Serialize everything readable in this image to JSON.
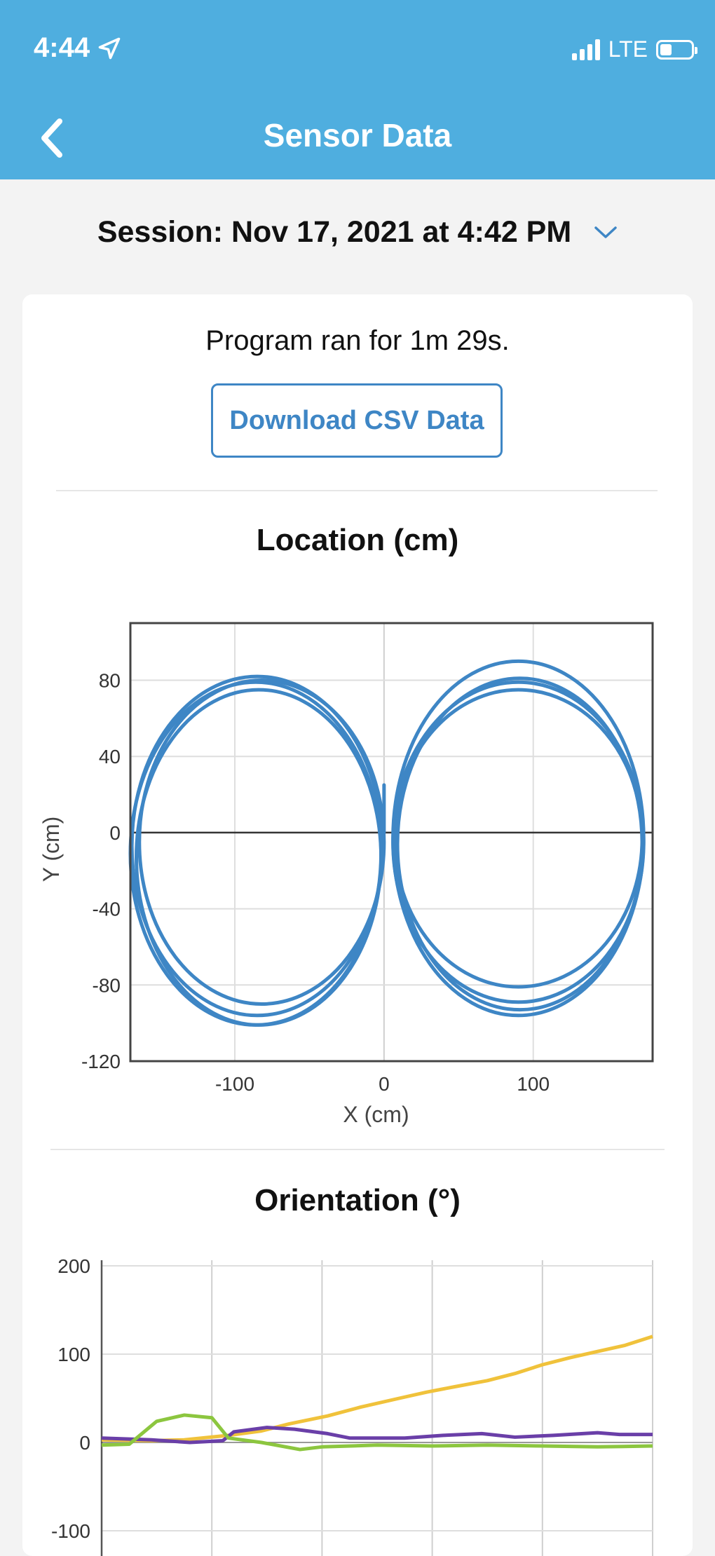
{
  "status_bar": {
    "time": "4:44",
    "network": "LTE"
  },
  "nav": {
    "title": "Sensor Data"
  },
  "session": {
    "label": "Session: Nov 17, 2021 at 4:42 PM"
  },
  "summary": {
    "runtime": "Program ran for 1m 29s."
  },
  "actions": {
    "download_csv": "Download CSV Data"
  },
  "colors": {
    "header": "#4faedf",
    "accent": "#3e86c5",
    "orientation_yellow": "#f0c23b",
    "orientation_purple": "#6a3fa8",
    "orientation_green": "#8cc63f"
  },
  "chart_data": [
    {
      "type": "line",
      "title": "Location (cm)",
      "xlabel": "X (cm)",
      "ylabel": "Y (cm)",
      "xlim": [
        -170,
        180
      ],
      "ylim": [
        -120,
        110
      ],
      "x_ticks": [
        "-100",
        "0",
        "100"
      ],
      "y_ticks": [
        "80",
        "40",
        "0",
        "-40",
        "-80",
        "-120"
      ],
      "grid": true,
      "series": [
        {
          "color": "#3e86c5",
          "loops": [
            {
              "cx": -82,
              "cy": -5,
              "rx": 82,
              "ry": 85
            },
            {
              "cx": -85,
              "cy": -7,
              "rx": 84,
              "ry": 89
            },
            {
              "cx": -86,
              "cy": -11,
              "rx": 84,
              "ry": 90
            },
            {
              "cx": -84,
              "cy": -13,
              "rx": 82,
              "ry": 88
            },
            {
              "cx": 90,
              "cy": -3,
              "rx": 83,
              "ry": 78
            },
            {
              "cx": 90,
              "cy": -5,
              "rx": 84,
              "ry": 84
            },
            {
              "cx": 90,
              "cy": -3,
              "rx": 84,
              "ry": 93
            },
            {
              "cx": 91,
              "cy": -6,
              "rx": 82,
              "ry": 87
            }
          ]
        }
      ]
    },
    {
      "type": "line",
      "title": "Orientation (°)",
      "ylim": [
        -100,
        200
      ],
      "y_ticks": [
        "200",
        "100",
        "0",
        "-100"
      ],
      "x_segments": 5,
      "grid": true,
      "series": [
        {
          "color": "#f0c23b",
          "x": [
            0,
            0.09,
            0.15,
            0.23,
            0.29,
            0.34,
            0.41,
            0.47,
            0.54,
            0.59,
            0.64,
            0.7,
            0.75,
            0.8,
            0.85,
            0.9,
            0.95,
            1.0
          ],
          "values": [
            3,
            2,
            3,
            8,
            13,
            21,
            30,
            40,
            50,
            57,
            63,
            70,
            78,
            88,
            96,
            103,
            110,
            120
          ]
        },
        {
          "color": "#6a3fa8",
          "x": [
            0,
            0.09,
            0.16,
            0.22,
            0.24,
            0.3,
            0.35,
            0.41,
            0.45,
            0.55,
            0.62,
            0.69,
            0.75,
            0.82,
            0.9,
            0.94,
            1.0
          ],
          "values": [
            5,
            3,
            0,
            2,
            12,
            17,
            15,
            10,
            5,
            5,
            8,
            10,
            6,
            8,
            11,
            9,
            9
          ]
        },
        {
          "color": "#8cc63f",
          "x": [
            0,
            0.05,
            0.1,
            0.15,
            0.2,
            0.23,
            0.29,
            0.36,
            0.4,
            0.5,
            0.6,
            0.7,
            0.8,
            0.9,
            1.0
          ],
          "values": [
            -3,
            -2,
            24,
            31,
            28,
            5,
            0,
            -8,
            -5,
            -3,
            -4,
            -3,
            -4,
            -5,
            -4
          ]
        }
      ]
    }
  ]
}
